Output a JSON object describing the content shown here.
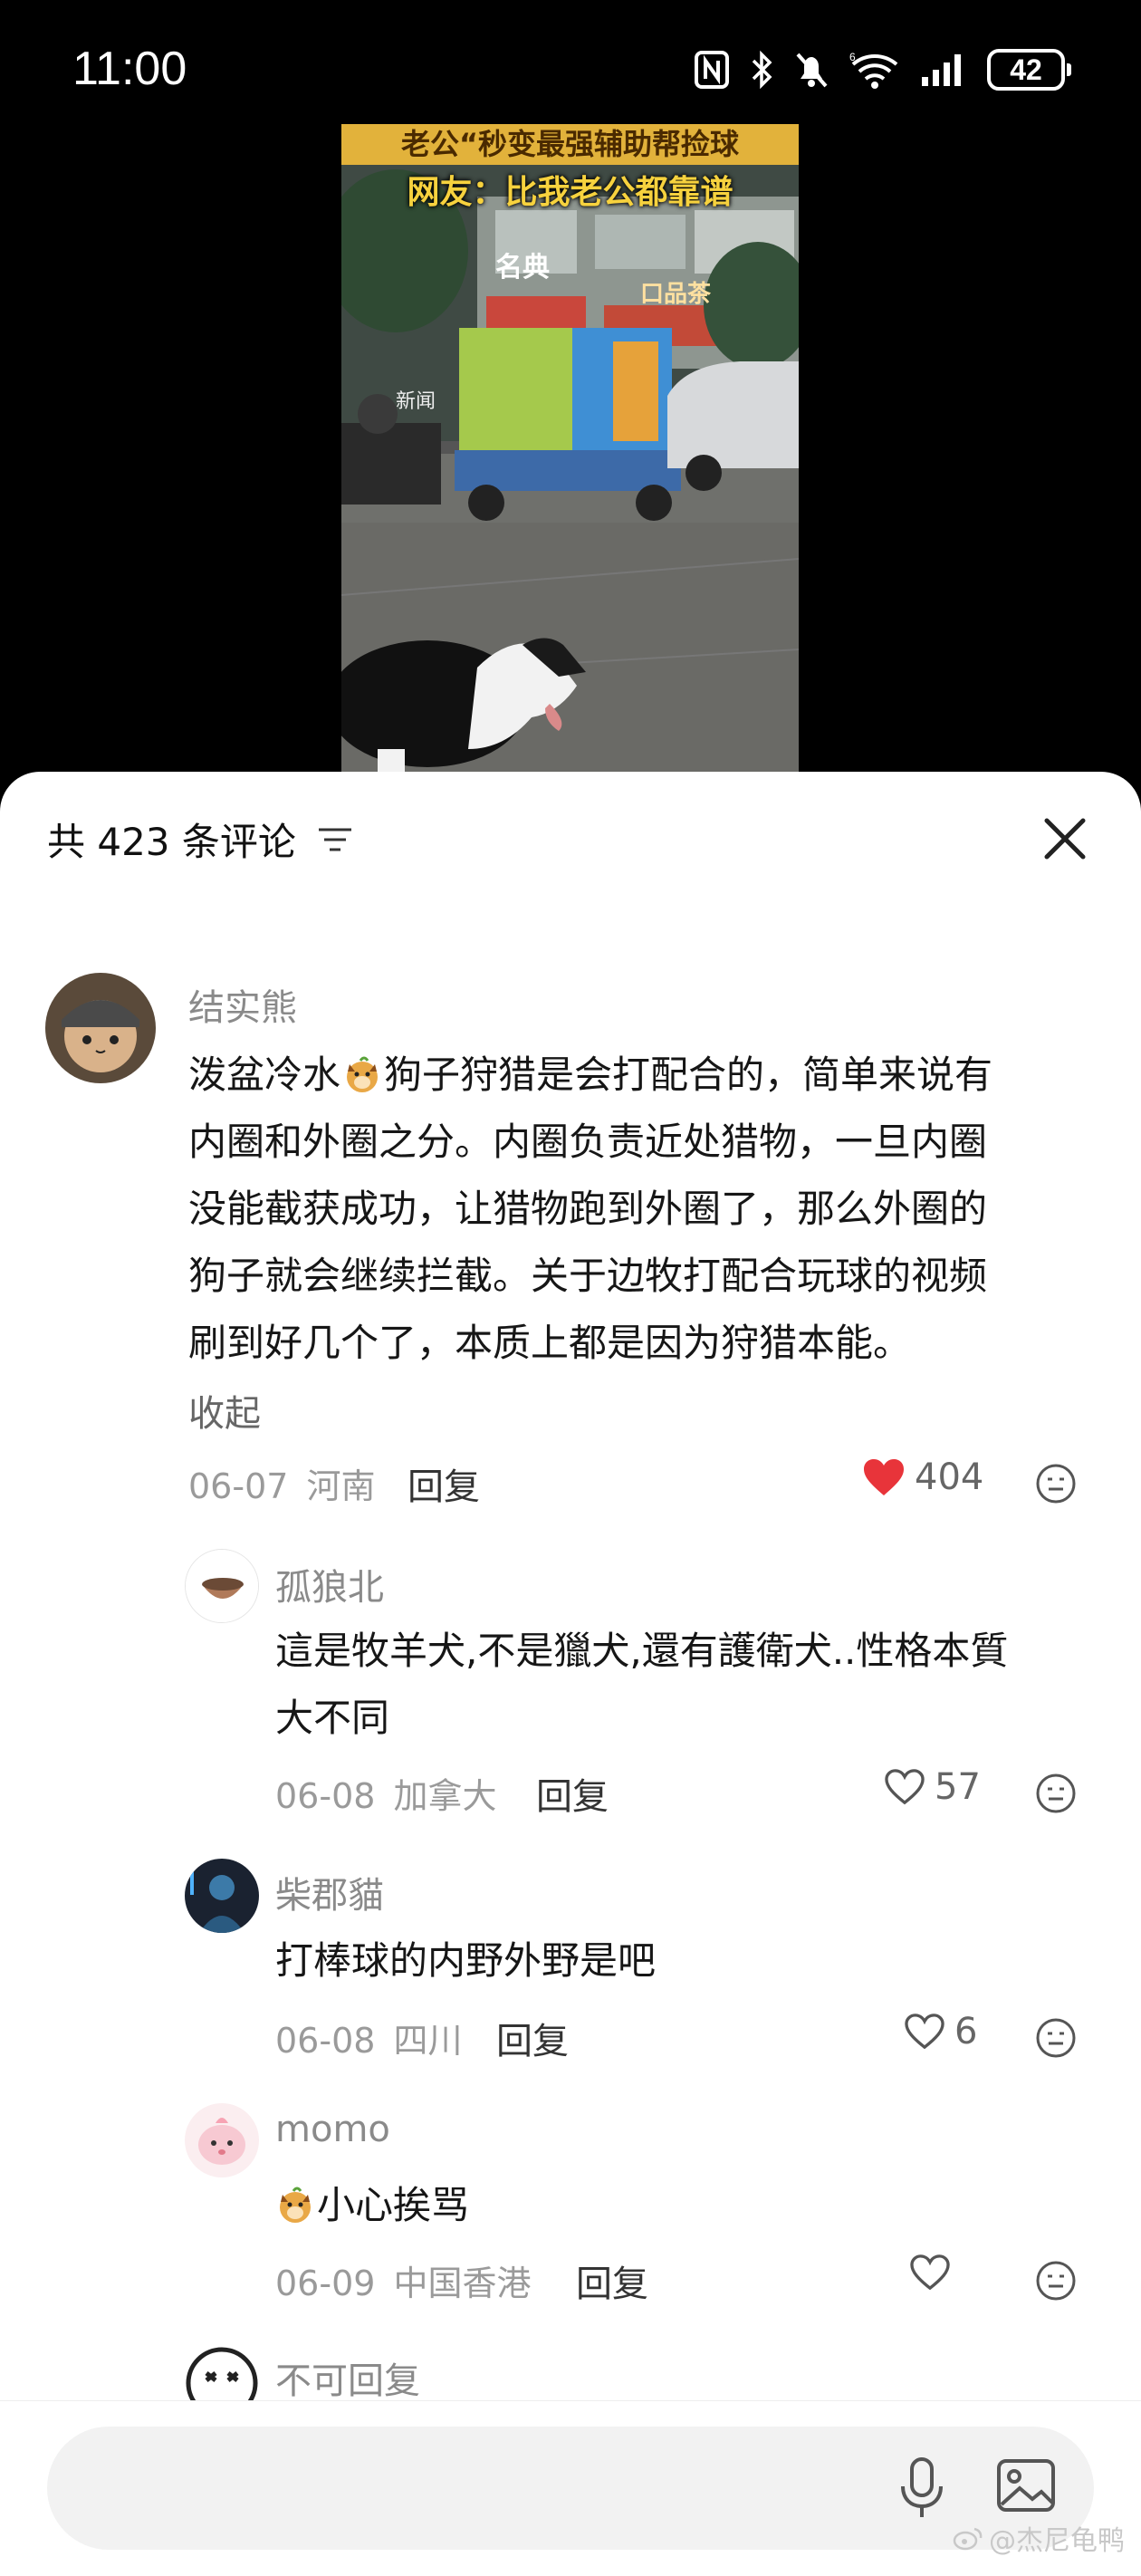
{
  "status_bar": {
    "time": "11:00",
    "battery": "42"
  },
  "video": {
    "banner": "老公“秒变最强辅助帮捡球",
    "subtitle": "网友：比我老公都靠谱",
    "shop_sign": "名典",
    "shop_sign2": "口品茶",
    "watermark": "新闻"
  },
  "comments_panel": {
    "count_label": "共 423 条评论",
    "comments": [
      {
        "author": "结实熊",
        "text_lines": [
          "泼盆冷水",
          "狗子狩猎是会打配合的，简单来说有",
          "内圈和外圈之分。内圈负责近处猎物，一旦内圈",
          "没能截获成功，让猎物跑到外圈了，那么外圈的",
          "狗子就会继续拦截。关于边牧打配合玩球的视频",
          "刷到好几个了，本质上都是因为狩猎本能。"
        ],
        "collapse": "收起",
        "date": "06-07",
        "location": "河南",
        "reply": "回复",
        "likes": "404",
        "liked": true
      },
      {
        "author": "孤狼北",
        "text_lines": [
          "這是牧羊犬,不是獵犬,還有護衛犬..性格本質",
          "大不同"
        ],
        "date": "06-08",
        "location": "加拿大",
        "reply": "回复",
        "likes": "57",
        "liked": false
      },
      {
        "author": "柴郡貓",
        "text_lines": [
          "打棒球的内野外野是吧"
        ],
        "date": "06-08",
        "location": "四川",
        "reply": "回复",
        "likes": "6",
        "liked": false
      },
      {
        "author": "momo",
        "text_lines": [
          "小心挨骂"
        ],
        "date": "06-09",
        "location": "中国香港",
        "reply": "回复",
        "likes": "",
        "liked": false
      },
      {
        "author": "不可回复"
      }
    ]
  },
  "input_bar": {
    "placeholder": "",
    "watermark": "@杰尼龟鸭"
  },
  "colors": {
    "like_red": "#e8343a",
    "sheet_bg": "#ffffff",
    "meta_gray": "#9a9a9a"
  }
}
